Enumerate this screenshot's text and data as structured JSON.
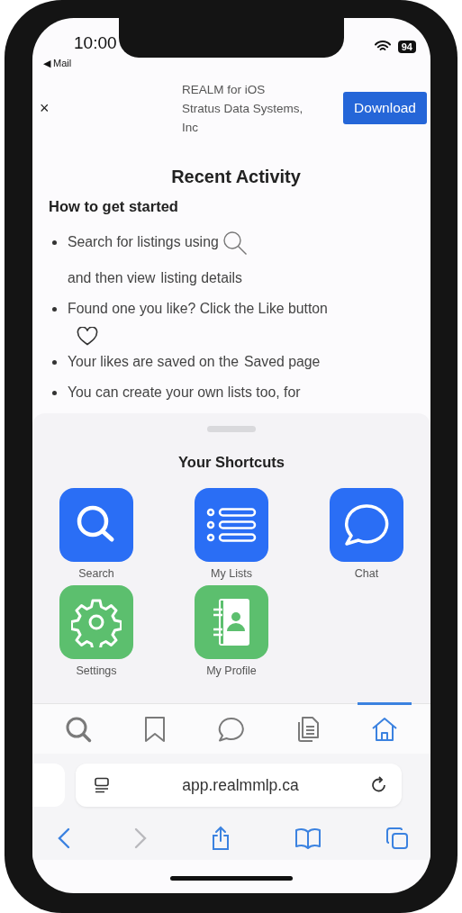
{
  "status_bar": {
    "time": "10:00",
    "back_app": "◀ Mail",
    "battery": "94"
  },
  "app_banner": {
    "close": "×",
    "app_name": "REALM for iOS",
    "developer": "Stratus Data Systems, Inc",
    "button": "Download"
  },
  "page": {
    "title": "Recent Activity",
    "heading": "How to get started",
    "bullets": [
      {
        "parts": [
          {
            "kind": "text",
            "text": "Search for listings using"
          },
          {
            "kind": "search_icon"
          },
          {
            "kind": "text",
            "text": "and then view"
          },
          {
            "kind": "text",
            "text": "listing details"
          }
        ]
      },
      {
        "parts": [
          {
            "kind": "text",
            "text": "Found one you like? Click the Like button"
          },
          {
            "kind": "heart_icon"
          }
        ]
      },
      {
        "parts": [
          {
            "kind": "text",
            "text": "Your likes are saved on the"
          },
          {
            "kind": "text",
            "text": "Saved page"
          }
        ]
      },
      {
        "parts": [
          {
            "kind": "text",
            "text": "You can create your own lists too, for"
          }
        ]
      }
    ]
  },
  "shortcuts": {
    "title": "Your Shortcuts",
    "items": [
      {
        "kind": "search",
        "label": "Search",
        "color": "#2a6ef5"
      },
      {
        "kind": "list",
        "label": "My Lists",
        "color": "#2a6ef5"
      },
      {
        "kind": "chat",
        "label": "Chat",
        "color": "#2a6ef5"
      },
      {
        "kind": "gear",
        "label": "Settings",
        "color": "#5cbf6e"
      },
      {
        "kind": "contacts",
        "label": "My Profile",
        "color": "#5cbf6e"
      }
    ]
  },
  "tab_bar": [
    {
      "kind": "search",
      "selected": false
    },
    {
      "kind": "bookmark",
      "selected": false
    },
    {
      "kind": "chat",
      "selected": false
    },
    {
      "kind": "document",
      "selected": false
    },
    {
      "kind": "home",
      "selected": true
    }
  ],
  "address_bar": {
    "url": "app.realmmlp.ca"
  },
  "toolbar": [
    {
      "kind": "back",
      "disabled": false
    },
    {
      "kind": "forward",
      "disabled": true
    },
    {
      "kind": "share",
      "disabled": false
    },
    {
      "kind": "book",
      "disabled": false
    },
    {
      "kind": "tabs",
      "disabled": false
    }
  ]
}
